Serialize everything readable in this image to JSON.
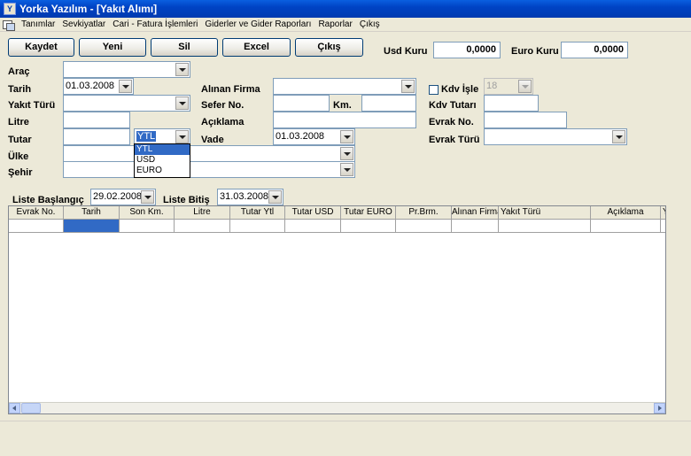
{
  "window": {
    "title": "Yorka Yazılım - [Yakıt Alımı]"
  },
  "menu": [
    "Tanımlar",
    "Sevkiyatlar",
    "Cari - Fatura İşlemleri",
    "Giderler ve Gider Raporları",
    "Raporlar",
    "Çıkış"
  ],
  "toolbar": {
    "save": "Kaydet",
    "new": "Yeni",
    "delete": "Sil",
    "excel": "Excel",
    "exit": "Çıkış"
  },
  "rates": {
    "usd_label": "Usd Kuru",
    "usd_value": "0,0000",
    "euro_label": "Euro Kuru",
    "euro_value": "0,0000"
  },
  "form": {
    "arac_label": "Araç",
    "arac_value": "",
    "tarih_label": "Tarih",
    "tarih_value": "01.03.2008",
    "yakit_turu_label": "Yakıt Türü",
    "yakit_turu_value": "",
    "litre_label": "Litre",
    "litre_value": "",
    "tutar_label": "Tutar",
    "tutar_value": "",
    "currency_value": "YTL",
    "ulke_label": "Ülke",
    "ulke_value": "",
    "sehir_label": "Şehir",
    "sehir_value": "",
    "alinan_firma_label": "Alınan Firma",
    "alinan_firma_value": "",
    "sefer_no_label": "Sefer No.",
    "sefer_no_value": "",
    "km_label": "Km.",
    "km_value": "",
    "aciklama_label": "Açıklama",
    "aciklama_value": "",
    "vade_label": "Vade",
    "vade_value": "01.03.2008",
    "kdv_isle_label": "Kdv İşle",
    "kdv_rate": "18",
    "kdv_tutari_label": "Kdv Tutarı",
    "kdv_tutari_value": "",
    "evrak_no_label": "Evrak No.",
    "evrak_no_value": "",
    "evrak_turu_label": "Evrak Türü",
    "evrak_turu_value": ""
  },
  "currency_options": [
    "YTL",
    "USD",
    "EURO"
  ],
  "list": {
    "start_label": "Liste Başlangıç",
    "start_value": "29.02.2008",
    "end_label": "Liste Bitiş",
    "end_value": "31.03.2008"
  },
  "table": {
    "columns": [
      "Evrak No.",
      "Tarih",
      "Son Km.",
      "Litre",
      "Tutar Ytl",
      "Tutar USD",
      "Tutar EURO",
      "Pr.Brm.",
      "Alınan Firma",
      "Yakıt Türü",
      "Açıklama",
      "Y"
    ]
  }
}
